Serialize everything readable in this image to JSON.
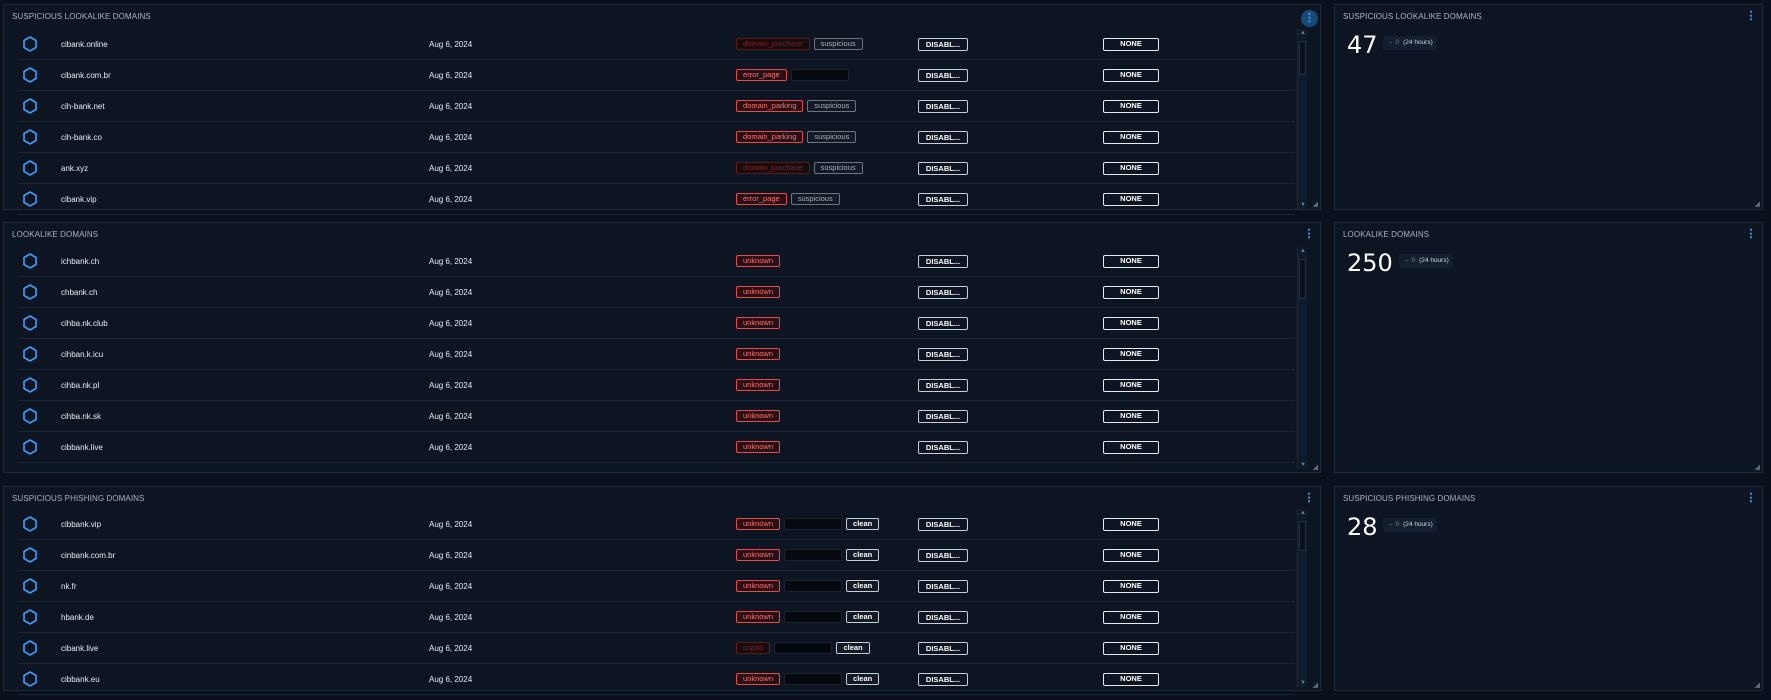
{
  "panels": [
    {
      "title": "SUSPICIOUS LOOKALIKE DOMAINS",
      "rows": [
        {
          "domain": "cibank.online",
          "date": "Aug 6, 2024",
          "tags": [
            {
              "text": "domain_purchase",
              "style": "darkred"
            },
            {
              "text": "suspicious",
              "style": "gray"
            }
          ],
          "status": "DISABL...",
          "action": "NONE"
        },
        {
          "domain": "cibank.com.br",
          "date": "Aug 6, 2024",
          "tags": [
            {
              "text": "error_page",
              "style": "red"
            },
            {
              "text": "",
              "style": "dark"
            }
          ],
          "status": "DISABL...",
          "action": "NONE"
        },
        {
          "domain": "cih-bank.net",
          "date": "Aug 6, 2024",
          "tags": [
            {
              "text": "domain_parking",
              "style": "red"
            },
            {
              "text": "suspicious",
              "style": "gray"
            }
          ],
          "status": "DISABL...",
          "action": "NONE"
        },
        {
          "domain": "cih-bank.co",
          "date": "Aug 6, 2024",
          "tags": [
            {
              "text": "domain_parking",
              "style": "red"
            },
            {
              "text": "suspicious",
              "style": "gray"
            }
          ],
          "status": "DISABL...",
          "action": "NONE"
        },
        {
          "domain": "ank.xyz",
          "date": "Aug 6, 2024",
          "tags": [
            {
              "text": "domain_purchase",
              "style": "darkred"
            },
            {
              "text": "suspicious",
              "style": "gray"
            }
          ],
          "status": "DISABL...",
          "action": "NONE"
        },
        {
          "domain": "cibank.vip",
          "date": "Aug 6, 2024",
          "tags": [
            {
              "text": "error_page",
              "style": "red"
            },
            {
              "text": "suspicious",
              "style": "gray"
            }
          ],
          "status": "DISABL...",
          "action": "NONE"
        }
      ]
    },
    {
      "title": "LOOKALIKE DOMAINS",
      "rows": [
        {
          "domain": "ichbank.ch",
          "date": "Aug 6, 2024",
          "tags": [
            {
              "text": "unknown",
              "style": "red"
            }
          ],
          "status": "DISABL...",
          "action": "NONE"
        },
        {
          "domain": "chbank.ch",
          "date": "Aug 6, 2024",
          "tags": [
            {
              "text": "unknown",
              "style": "red"
            }
          ],
          "status": "DISABL...",
          "action": "NONE"
        },
        {
          "domain": "cihba.nk.club",
          "date": "Aug 6, 2024",
          "tags": [
            {
              "text": "unknown",
              "style": "red"
            }
          ],
          "status": "DISABL...",
          "action": "NONE"
        },
        {
          "domain": "cihban.k.icu",
          "date": "Aug 6, 2024",
          "tags": [
            {
              "text": "unknown",
              "style": "red"
            }
          ],
          "status": "DISABL...",
          "action": "NONE"
        },
        {
          "domain": "cihba.nk.pl",
          "date": "Aug 6, 2024",
          "tags": [
            {
              "text": "unknown",
              "style": "red"
            }
          ],
          "status": "DISABL...",
          "action": "NONE"
        },
        {
          "domain": "cihba.nk.sk",
          "date": "Aug 6, 2024",
          "tags": [
            {
              "text": "unknown",
              "style": "red"
            }
          ],
          "status": "DISABL...",
          "action": "NONE"
        },
        {
          "domain": "cibbank.live",
          "date": "Aug 6, 2024",
          "tags": [
            {
              "text": "unknown",
              "style": "red"
            }
          ],
          "status": "DISABL...",
          "action": "NONE"
        }
      ]
    },
    {
      "title": "SUSPICIOUS PHISHING DOMAINS",
      "rows": [
        {
          "domain": "cibbank.vip",
          "date": "Aug 6, 2024",
          "tags": [
            {
              "text": "unknown",
              "style": "red"
            },
            {
              "text": "",
              "style": "dark"
            },
            {
              "text": "clean",
              "style": "white"
            }
          ],
          "status": "DISABL...",
          "action": "NONE"
        },
        {
          "domain": "cinbank.com.br",
          "date": "Aug 6, 2024",
          "tags": [
            {
              "text": "unknown",
              "style": "red"
            },
            {
              "text": "",
              "style": "dark"
            },
            {
              "text": "clean",
              "style": "white"
            }
          ],
          "status": "DISABL...",
          "action": "NONE"
        },
        {
          "domain": "nk.fr",
          "date": "Aug 6, 2024",
          "tags": [
            {
              "text": "unknown",
              "style": "red"
            },
            {
              "text": "",
              "style": "dark"
            },
            {
              "text": "clean",
              "style": "white"
            }
          ],
          "status": "DISABL...",
          "action": "NONE"
        },
        {
          "domain": "hbank.de",
          "date": "Aug 6, 2024",
          "tags": [
            {
              "text": "unknown",
              "style": "red"
            },
            {
              "text": "",
              "style": "dark"
            },
            {
              "text": "clean",
              "style": "white"
            }
          ],
          "status": "DISABL...",
          "action": "NONE"
        },
        {
          "domain": "cibank.live",
          "date": "Aug 6, 2024",
          "tags": [
            {
              "text": "crypto",
              "style": "darkred"
            },
            {
              "text": "",
              "style": "dark"
            },
            {
              "text": "clean",
              "style": "white"
            }
          ],
          "status": "DISABL...",
          "action": "NONE"
        },
        {
          "domain": "cibbank.eu",
          "date": "Aug 6, 2024",
          "tags": [
            {
              "text": "unknown",
              "style": "red"
            },
            {
              "text": "",
              "style": "dark"
            },
            {
              "text": "clean",
              "style": "white"
            }
          ],
          "status": "DISABL...",
          "action": "NONE"
        }
      ]
    }
  ],
  "stats": [
    {
      "title": "SUSPICIOUS LOOKALIKE DOMAINS",
      "count": "47",
      "change": "0",
      "period": "(24 hours)"
    },
    {
      "title": "LOOKALIKE DOMAINS",
      "count": "250",
      "change": "0",
      "period": "(24 hours)"
    },
    {
      "title": "SUSPICIOUS PHISHING DOMAINS",
      "count": "28",
      "change": "0",
      "period": "(24 hours)"
    }
  ],
  "icons": {
    "menu": "more-vertical-icon",
    "domain": "hexagon-icon"
  },
  "colors": {
    "accent": "#4aa3ff",
    "danger": "#e34c4c",
    "background": "#0b111c"
  }
}
